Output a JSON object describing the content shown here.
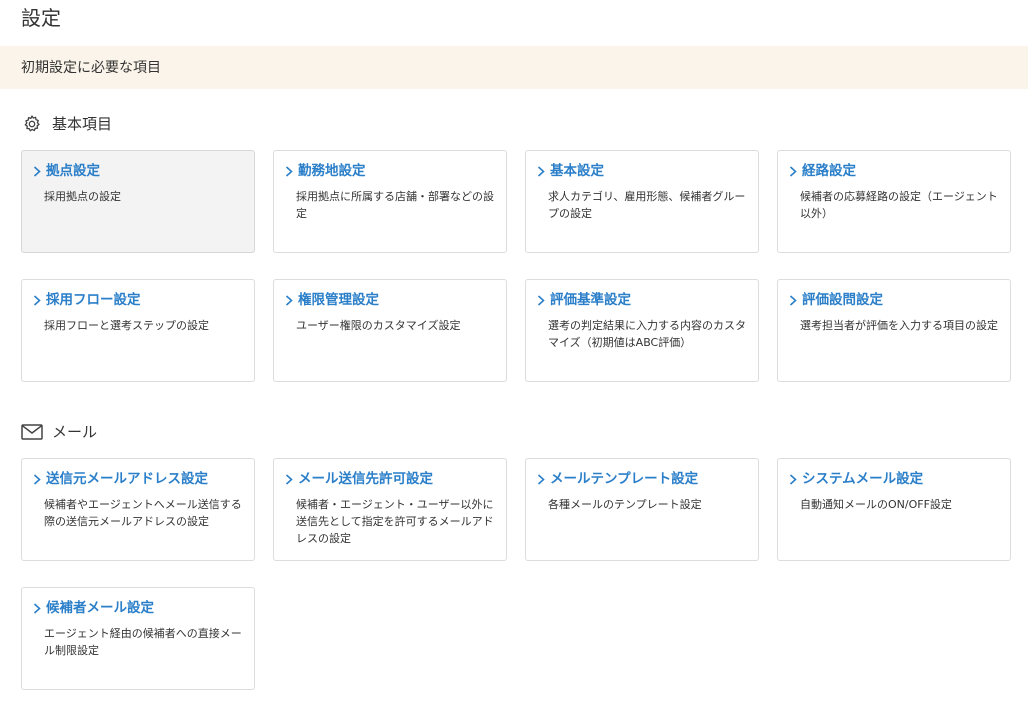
{
  "page": {
    "title": "設定",
    "banner": "初期設定に必要な項目"
  },
  "sections": {
    "basic": {
      "label": "基本項目",
      "icon": "gear-icon",
      "cards": [
        {
          "title": "拠点設定",
          "desc": "採用拠点の設定"
        },
        {
          "title": "勤務地設定",
          "desc": "採用拠点に所属する店舗・部署などの設定"
        },
        {
          "title": "基本設定",
          "desc": "求人カテゴリ、雇用形態、候補者グループの設定"
        },
        {
          "title": "経路設定",
          "desc": "候補者の応募経路の設定（エージェント以外）"
        },
        {
          "title": "採用フロー設定",
          "desc": "採用フローと選考ステップの設定"
        },
        {
          "title": "権限管理設定",
          "desc": "ユーザー権限のカスタマイズ設定"
        },
        {
          "title": "評価基準設定",
          "desc": "選考の判定結果に入力する内容のカスタマイズ（初期値はABC評価）"
        },
        {
          "title": "評価設問設定",
          "desc": "選考担当者が評価を入力する項目の設定"
        }
      ]
    },
    "mail": {
      "label": "メール",
      "icon": "mail-icon",
      "cards": [
        {
          "title": "送信元メールアドレス設定",
          "desc": "候補者やエージェントへメール送信する際の送信元メールアドレスの設定"
        },
        {
          "title": "メール送信先許可設定",
          "desc": "候補者・エージェント・ユーザー以外に送信先として指定を許可するメールアドレスの設定"
        },
        {
          "title": "メールテンプレート設定",
          "desc": "各種メールのテンプレート設定"
        },
        {
          "title": "システムメール設定",
          "desc": "自動通知メールのON/OFF設定"
        },
        {
          "title": "候補者メール設定",
          "desc": "エージェント経由の候補者への直接メール制限設定"
        }
      ]
    }
  },
  "colors": {
    "link": "#2b7fc9",
    "banner": "#fbf4ea",
    "border": "#dcdcdc",
    "hover": "#f3f3f3"
  }
}
